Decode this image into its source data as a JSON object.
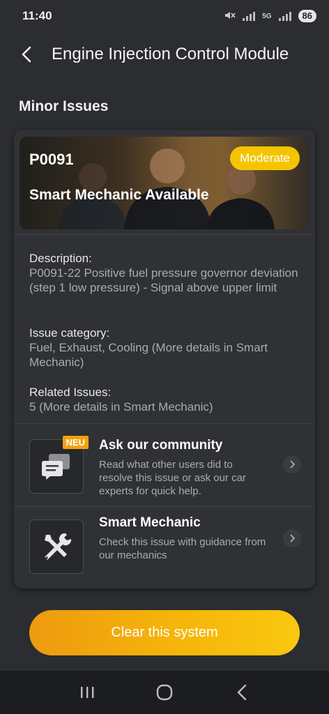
{
  "status_bar": {
    "time": "11:40",
    "network": "5G",
    "battery": "86"
  },
  "header": {
    "title": "Engine Injection Control Module"
  },
  "section": {
    "title": "Minor Issues"
  },
  "issue": {
    "code": "P0091",
    "severity": "Moderate",
    "banner_text": "Smart Mechanic Available",
    "description_label": "Description:",
    "description_value": "P0091-22 Positive fuel pressure governor deviation (step 1 low pressure) - Signal above upper limit",
    "category_label": "Issue category:",
    "category_value": "Fuel, Exhaust, Cooling (More details in Smart Mechanic)",
    "related_label": "Related Issues:",
    "related_value": "5 (More details in Smart Mechanic)"
  },
  "actions": [
    {
      "title": "Ask our community",
      "description": "Read what other users did to resolve this issue or ask our car experts for quick help.",
      "tag": "NEU",
      "icon": "chat-icon"
    },
    {
      "title": "Smart Mechanic",
      "description": "Check this issue with guidance from our mechanics",
      "icon": "tools-icon"
    }
  ],
  "cta": {
    "label": "Clear this system"
  },
  "colors": {
    "background": "#2b2d31",
    "card": "#2f3135",
    "accent": "#f5c400",
    "cta_start": "#ee9a10",
    "cta_end": "#f9c810"
  }
}
